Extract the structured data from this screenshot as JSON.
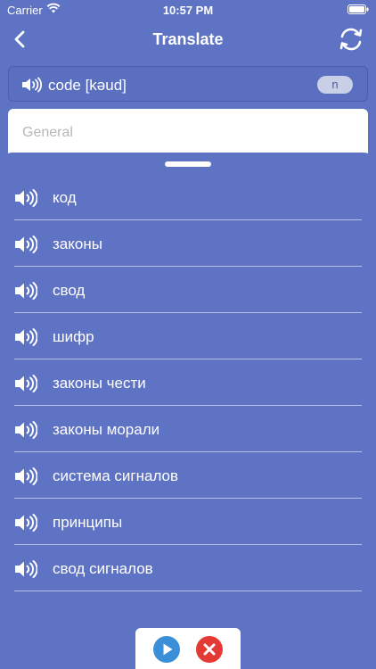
{
  "status": {
    "carrier": "Carrier",
    "time": "10:57 PM"
  },
  "nav": {
    "title": "Translate"
  },
  "word": {
    "text": "code [kəud]",
    "pos": "n"
  },
  "general": {
    "label": "General"
  },
  "translations": [
    "код",
    "законы",
    "свод",
    "шифр",
    "законы чести",
    "законы морали",
    "система сигналов",
    "принципы",
    "свод сигналов"
  ],
  "colors": {
    "background": "#5f73c4",
    "play": "#3b8ed8",
    "close": "#e53935"
  }
}
